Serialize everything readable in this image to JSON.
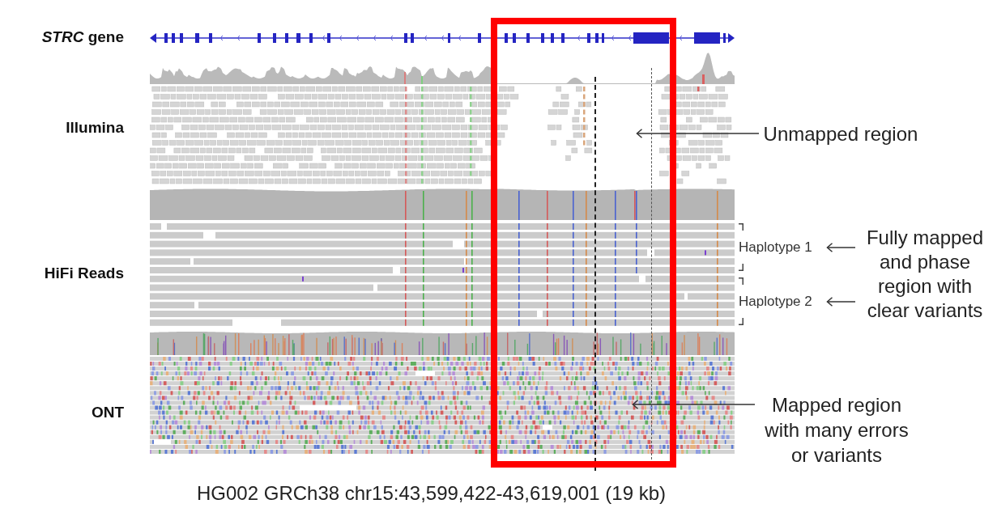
{
  "gene_track": {
    "label": "*STRC* gene"
  },
  "read_tracks": [
    {
      "kind": "short",
      "label": "Illumina",
      "annotation": "Unmapped region"
    },
    {
      "kind": "long",
      "label": "HiFi Reads",
      "haplotypes": [
        "Haplotype 1",
        "Haplotype 2"
      ],
      "annotation": "Fully mapped and phase region with clear variants"
    },
    {
      "kind": "noisy",
      "label": "ONT",
      "annotation": "Mapped region with many errors or variants"
    }
  ],
  "caption": "HG002 GRCh38 chr15:43,599,422-43,619,001 (19 kb)"
}
